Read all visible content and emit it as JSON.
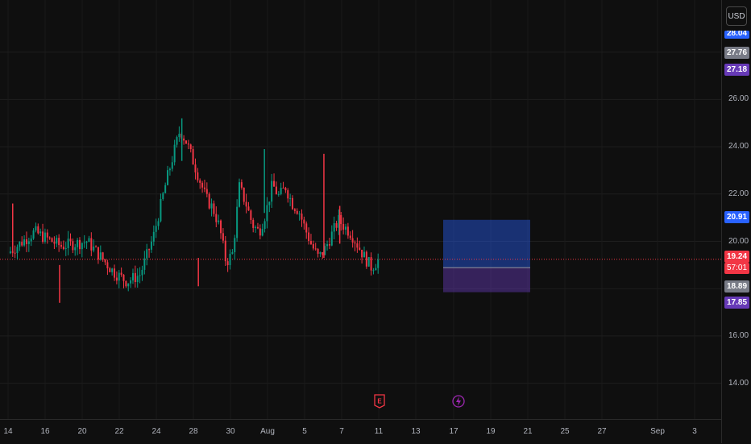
{
  "chart_data": {
    "type": "candlestick",
    "currency": "USD",
    "ylim": [
      12.8,
      28.1
    ],
    "price_ticks": [
      "14.00",
      "16.00",
      "18.00",
      "20.00",
      "22.00",
      "24.00",
      "26.00"
    ],
    "time_ticks": [
      "14",
      "16",
      "20",
      "22",
      "24",
      "28",
      "30",
      "Aug",
      "5",
      "7",
      "11",
      "13",
      "17",
      "19",
      "21",
      "25",
      "27",
      "Sep",
      "3"
    ],
    "current_price": "19.24",
    "countdown": "57:01",
    "price_tags": [
      {
        "label": "28.04",
        "color": "#2962ff"
      },
      {
        "label": "27.76",
        "color": "#787b86"
      },
      {
        "label": "27.18",
        "color": "#673ab7"
      },
      {
        "label": "20.91",
        "color": "#2962ff"
      },
      {
        "label": "19.24",
        "color": "#f23645"
      },
      {
        "label": "18.89",
        "color": "#787b86"
      },
      {
        "label": "17.85",
        "color": "#673ab7"
      }
    ],
    "position_tool": {
      "target": 20.91,
      "entry": 18.89,
      "stop": 17.85
    },
    "close_path": [
      [
        0,
        19.5
      ],
      [
        4,
        20.4
      ],
      [
        8,
        19.8
      ],
      [
        12,
        20.0
      ],
      [
        16,
        18.7
      ],
      [
        18,
        18.3
      ],
      [
        20,
        18.6
      ],
      [
        22,
        20.2
      ],
      [
        24,
        22.6
      ],
      [
        26,
        24.7
      ],
      [
        27,
        24.2
      ],
      [
        28,
        23.4
      ],
      [
        30,
        21.8
      ],
      [
        31,
        21.4
      ],
      [
        32,
        20.6
      ],
      [
        33,
        19.1
      ],
      [
        34,
        19.5
      ],
      [
        35,
        22.3
      ],
      [
        36,
        21.6
      ],
      [
        37,
        20.7
      ],
      [
        38,
        20.4
      ],
      [
        39,
        21.2
      ],
      [
        40,
        22.4
      ],
      [
        41,
        21.9
      ],
      [
        42,
        22.3
      ],
      [
        43,
        21.6
      ],
      [
        44,
        21.3
      ],
      [
        45,
        20.5
      ],
      [
        46,
        19.8
      ],
      [
        47,
        19.3
      ],
      [
        48,
        19.7
      ],
      [
        50,
        20.9
      ],
      [
        52,
        20.3
      ],
      [
        54,
        19.3
      ],
      [
        55,
        18.9
      ],
      [
        56,
        19.2
      ]
    ],
    "spikes": [
      {
        "x": 47.8,
        "high": 23.7,
        "low": 19.3,
        "color": "#f23645"
      },
      {
        "x": 38.8,
        "high": 23.9,
        "low": 21.2,
        "color": "#089981"
      },
      {
        "x": 26.3,
        "high": 25.2,
        "low": 23.4,
        "color": "#089981"
      },
      {
        "x": 7.8,
        "high": 17.4,
        "low": 19.0,
        "color": "#f23645"
      },
      {
        "x": 28.8,
        "high": 19.3,
        "low": 18.1,
        "color": "#f23645"
      },
      {
        "x": 0.7,
        "high": 21.6,
        "low": 19.5,
        "color": "#f23645"
      },
      {
        "x": 50.2,
        "high": 21.5,
        "low": 19.9,
        "color": "#f23645"
      }
    ],
    "events": [
      {
        "name": "earnings-icon",
        "color": "#f23645",
        "day": 48
      },
      {
        "name": "dividend-lightning-icon",
        "color": "#9c27b0",
        "day": 57.8
      }
    ]
  }
}
